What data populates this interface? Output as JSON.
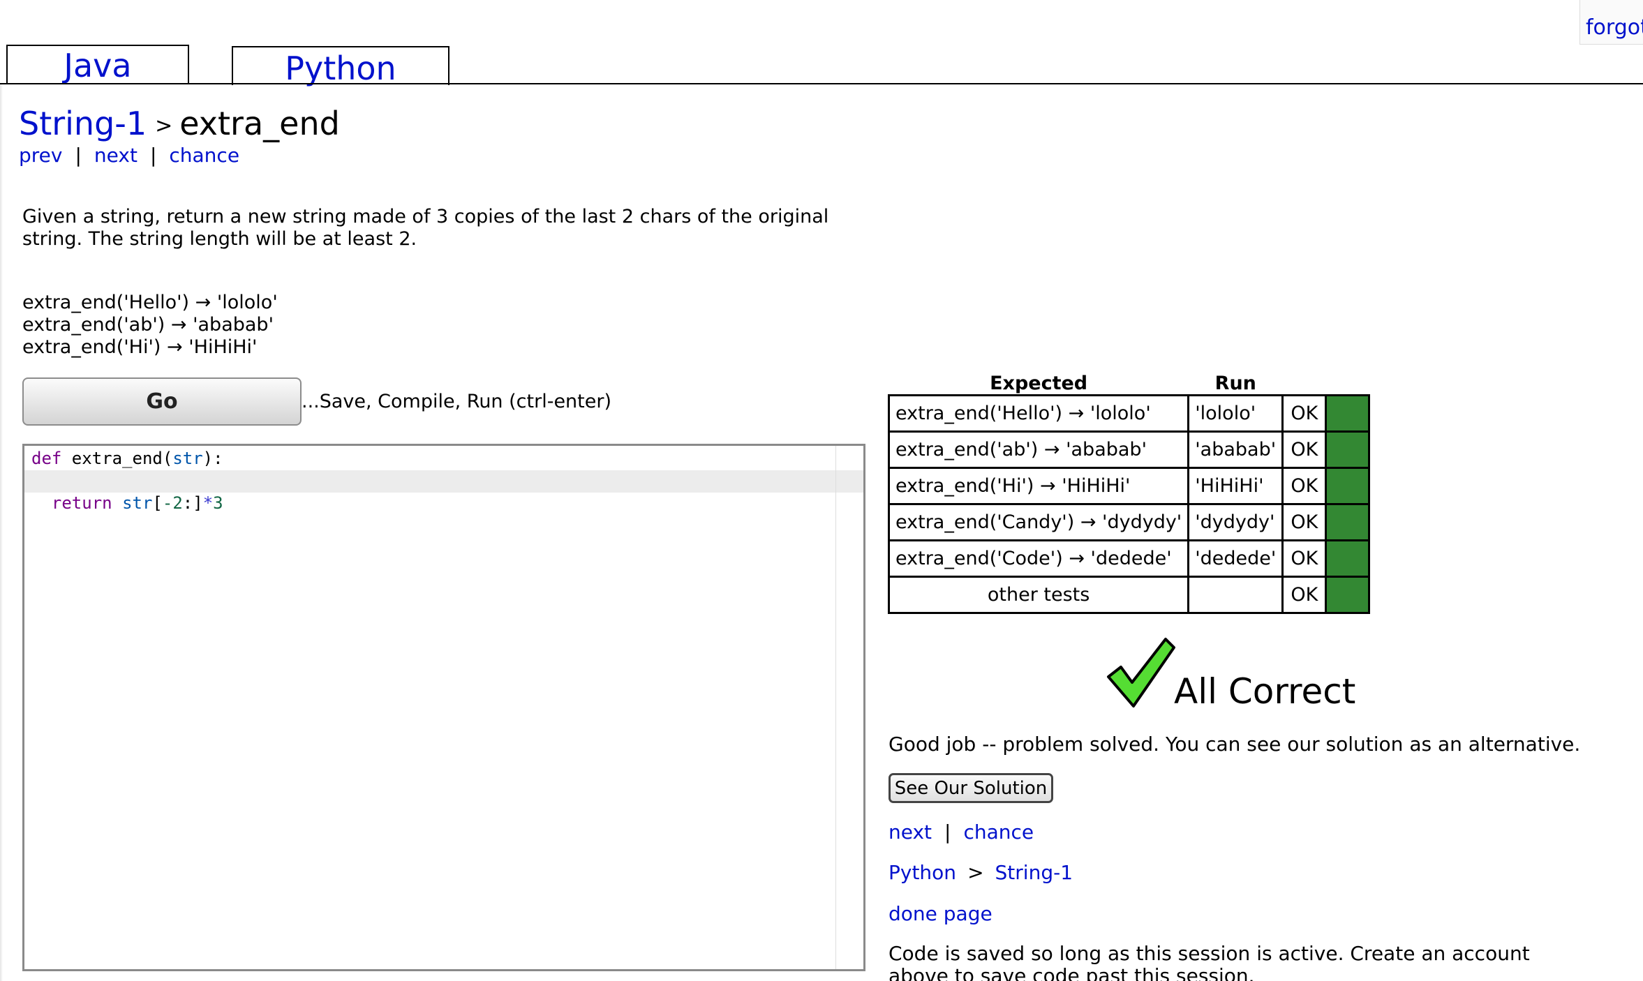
{
  "topbar": {
    "forgot_label": "forgot"
  },
  "tabs": [
    {
      "label": "Java",
      "active": false
    },
    {
      "label": "Python",
      "active": true
    }
  ],
  "breadcrumb": {
    "section": "String-1",
    "separator": ">",
    "problem": "extra_end"
  },
  "nav_top": {
    "prev": "prev",
    "next": "next",
    "chance": "chance",
    "separator": "|"
  },
  "problem": {
    "description": "Given a string, return a new string made of 3 copies of the last 2 chars of the original string. The string length will be at least 2.",
    "examples": [
      "extra_end('Hello') → 'lololo'",
      "extra_end('ab') → 'ababab'",
      "extra_end('Hi') → 'HiHiHi'"
    ]
  },
  "go": {
    "label": "Go",
    "hint": "...Save, Compile, Run (ctrl-enter)"
  },
  "editor": {
    "line1": {
      "kw": "def",
      "fn": " extra_end(",
      "param": "str",
      "end": "):"
    },
    "line2": {
      "indent": "  ",
      "kw": "return",
      "sp": " ",
      "var": "str",
      "b1": "[",
      "num1": "-2",
      "colon": ":",
      "b2": "]",
      "op": "*",
      "num2": "3"
    }
  },
  "results": {
    "headers": {
      "expected": "Expected",
      "run": "Run"
    },
    "rows": [
      {
        "expected": "extra_end('Hello') → 'lololo'",
        "run": "'lololo'",
        "status": "OK"
      },
      {
        "expected": "extra_end('ab') → 'ababab'",
        "run": "'ababab'",
        "status": "OK"
      },
      {
        "expected": "extra_end('Hi') → 'HiHiHi'",
        "run": "'HiHiHi'",
        "status": "OK"
      },
      {
        "expected": "extra_end('Candy') → 'dydydy'",
        "run": "'dydydy'",
        "status": "OK"
      },
      {
        "expected": "extra_end('Code') → 'dedede'",
        "run": "'dedede'",
        "status": "OK"
      },
      {
        "expected": "other tests",
        "run": "",
        "status": "OK"
      }
    ],
    "pass_color": "#338833"
  },
  "outcome": {
    "title": "All Correct",
    "message": "Good job -- problem solved. You can see our solution as an alternative.",
    "solution_button": "See Our Solution",
    "check_icon": "check-icon",
    "check_color": "#55dd33"
  },
  "nav_bottom": {
    "next": "next",
    "chance": "chance",
    "separator": "|"
  },
  "crumb_bottom": {
    "language": "Python",
    "separator": ">",
    "section": "String-1"
  },
  "done_page": "done page",
  "saved_note": "Code is saved so long as this session is active. Create an account above to save code past this session."
}
